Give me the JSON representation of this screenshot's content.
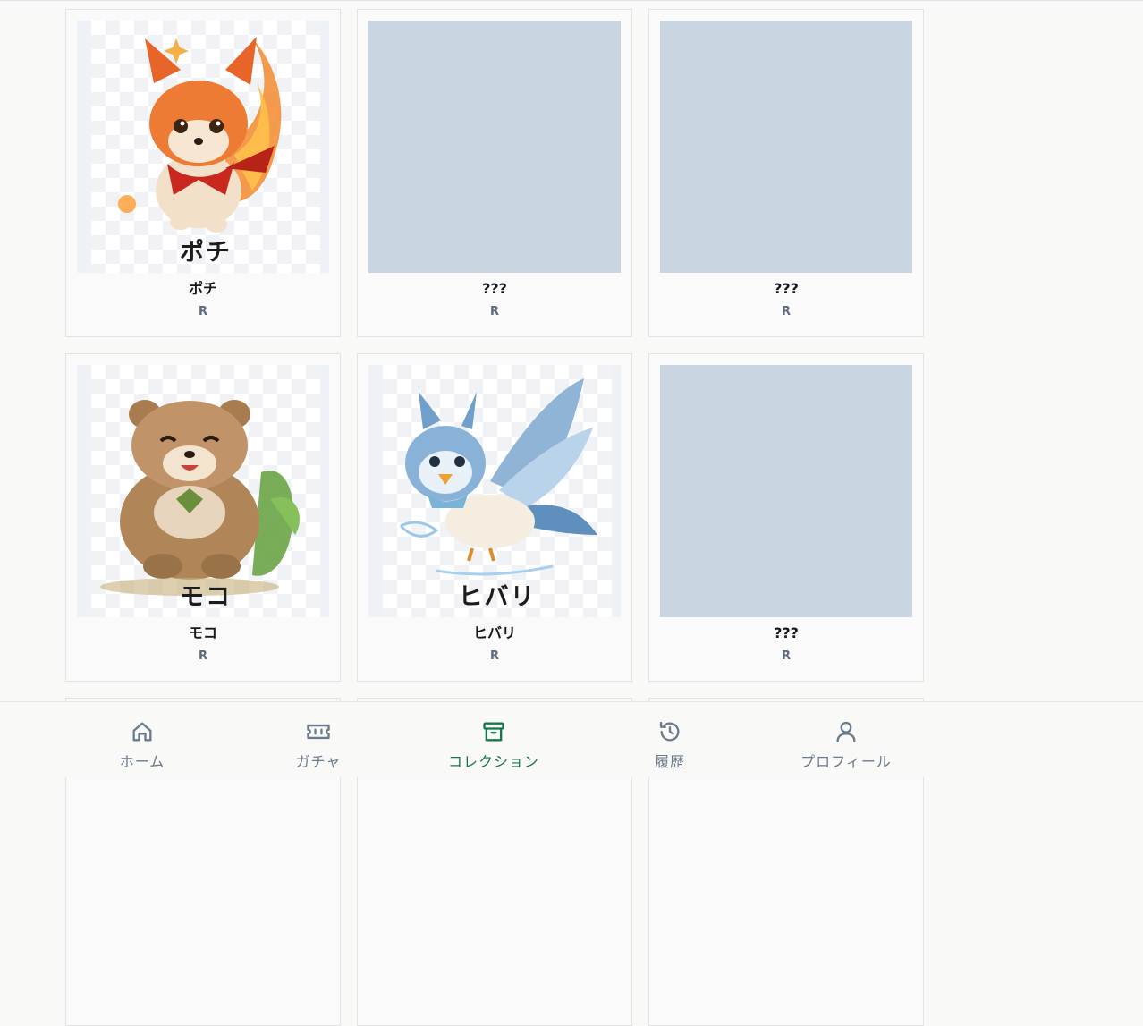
{
  "collection": {
    "cards": [
      {
        "name": "ポチ",
        "rarity": "R",
        "unlocked": true,
        "art_text": "ポチ",
        "art": "fire-dog"
      },
      {
        "name": "???",
        "rarity": "R",
        "unlocked": false
      },
      {
        "name": "???",
        "rarity": "R",
        "unlocked": false
      },
      {
        "name": "モコ",
        "rarity": "R",
        "unlocked": true,
        "art_text": "モコ",
        "art": "earth-bear"
      },
      {
        "name": "ヒバリ",
        "rarity": "R",
        "unlocked": true,
        "art_text": "ヒバリ",
        "art": "wind-bird"
      },
      {
        "name": "???",
        "rarity": "R",
        "unlocked": false
      }
    ]
  },
  "nav": {
    "items": [
      {
        "label": "ホーム",
        "icon": "home-icon",
        "active": false
      },
      {
        "label": "ガチャ",
        "icon": "ticket-icon",
        "active": false
      },
      {
        "label": "コレクション",
        "icon": "archive-box-icon",
        "active": true
      },
      {
        "label": "履歴",
        "icon": "history-icon",
        "active": false
      },
      {
        "label": "プロフィール",
        "icon": "user-icon",
        "active": false
      }
    ]
  },
  "colors": {
    "accent": "#15784a",
    "inactive": "#6b7a8c",
    "locked_placeholder": "#c9d5e1",
    "rarity_text": "#5d6b7d"
  }
}
